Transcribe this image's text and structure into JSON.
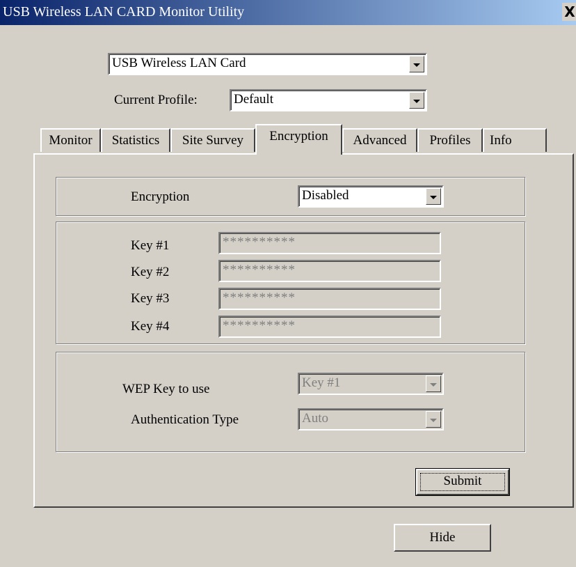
{
  "window": {
    "title": "USB Wireless LAN CARD Monitor Utility",
    "close_glyph": "X"
  },
  "adapter": {
    "selected": "USB Wireless LAN Card"
  },
  "profile": {
    "label": "Current Profile:",
    "selected": "Default"
  },
  "tabs": [
    {
      "label": "Monitor",
      "active": false
    },
    {
      "label": "Statistics",
      "active": false
    },
    {
      "label": "Site Survey",
      "active": false
    },
    {
      "label": "Encryption",
      "active": true
    },
    {
      "label": "Advanced",
      "active": false
    },
    {
      "label": "Profiles",
      "active": false
    },
    {
      "label": "Info",
      "active": false
    }
  ],
  "encryption": {
    "label": "Encryption",
    "selected": "Disabled"
  },
  "keys": [
    {
      "label": "Key #1",
      "value": "**********"
    },
    {
      "label": "Key #2",
      "value": "**********"
    },
    {
      "label": "Key #3",
      "value": "**********"
    },
    {
      "label": "Key #4",
      "value": "**********"
    }
  ],
  "wep": {
    "label": "WEP Key to use",
    "selected": "Key #1"
  },
  "auth": {
    "label": "Authentication Type",
    "selected": "Auto"
  },
  "buttons": {
    "submit": "Submit",
    "hide": "Hide"
  },
  "colors": {
    "title_bar_start": "#0a246a",
    "title_bar_end": "#a6caf0",
    "face": "#d4d0c8"
  }
}
